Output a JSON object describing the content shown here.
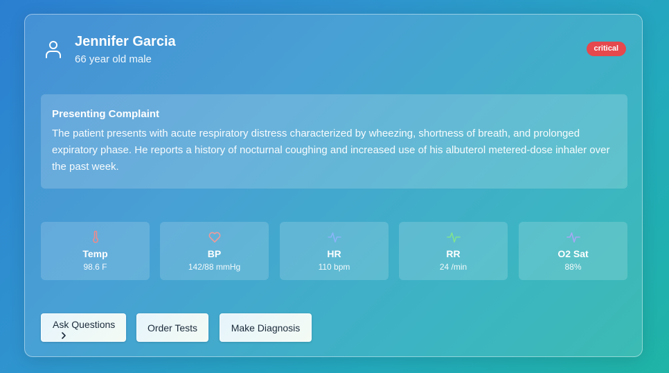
{
  "patient": {
    "name": "Jennifer Garcia",
    "subtitle": "66 year old male",
    "status_badge": "critical",
    "status_color": "#e5484d",
    "avatar_icon": "user-icon"
  },
  "complaint": {
    "title": "Presenting Complaint",
    "text": "The patient presents with acute respiratory distress characterized by wheezing, shortness of breath, and prolonged expiratory phase. He reports a history of nocturnal coughing and increased use of his albuterol metered-dose inhaler over the past week."
  },
  "vitals": [
    {
      "label": "Temp",
      "value": "98.6 F",
      "icon": "thermometer-icon",
      "icon_color": "#f08a8a"
    },
    {
      "label": "BP",
      "value": "142/88 mmHg",
      "icon": "heart-icon",
      "icon_color": "#f09a9a"
    },
    {
      "label": "HR",
      "value": "110 bpm",
      "icon": "pulse-icon",
      "icon_color": "#8ab4f8"
    },
    {
      "label": "RR",
      "value": "24 /min",
      "icon": "pulse-icon",
      "icon_color": "#7fe38f"
    },
    {
      "label": "O2 Sat",
      "value": "88%",
      "icon": "pulse-icon",
      "icon_color": "#a7a8f5"
    }
  ],
  "actions": {
    "ask_questions": "Ask Questions",
    "order_tests": "Order Tests",
    "make_diagnosis": "Make Diagnosis"
  }
}
